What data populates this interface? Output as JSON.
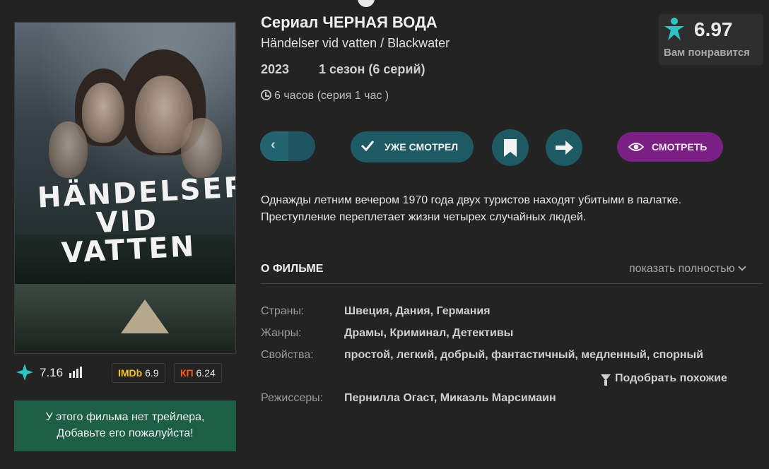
{
  "poster": {
    "title_art": "HÄNDELSER VID VATTEN"
  },
  "ratings": {
    "site_rating": "7.16",
    "imdb_label": "IMDb",
    "imdb_value": "6.9",
    "kp_label": "КП",
    "kp_value": "6.24"
  },
  "trailer_notice": {
    "line1": "У этого фильма нет трейлера,",
    "line2": "Добавьте его пожалуйста!"
  },
  "header": {
    "title": "Сериал ЧЕРНАЯ ВОДА",
    "original_title": "Händelser vid vatten / Blackwater",
    "year": "2023",
    "season": "1 сезон (6 серий)",
    "duration": "6 часов  (серия 1 час )"
  },
  "score": {
    "value": "6.97",
    "note": "Вам понравится"
  },
  "actions": {
    "seen_label": "УЖЕ СМОТРЕЛ",
    "watch_label": "СМОТРЕТЬ"
  },
  "description": {
    "line1": "Однажды летним вечером 1970 года двух туристов находят убитыми в палатке.",
    "line2": "Преступление переплетает жизни четырех случайных людей."
  },
  "about": {
    "heading": "О ФИЛЬМЕ",
    "show_full": "показать полностью",
    "countries_label": "Страны:",
    "countries": "Швеция,  Дания,  Германия",
    "genres_label": "Жанры:",
    "genres": "Драмы,  Криминал,  Детективы",
    "props_label": "Свойства:",
    "props": "простой,  легкий,  добрый,  фантастичный,  медленный,  спорный",
    "similar": "Подобрать похожие",
    "directors_label": "Режиссеры:",
    "directors": "Пернилла Огаст,  Микаэль Марсимаин"
  },
  "colors": {
    "accent_teal": "#1d5a63",
    "watch_purple": "#7a1f83",
    "trailer_green": "#1c5f45",
    "imdb_yellow": "#f5c518",
    "kp_orange": "#ff5c1a",
    "star_cyan": "#2ec4c4"
  },
  "icons": [
    "star-icon",
    "bars-icon",
    "clock-icon",
    "person-star-icon",
    "chevron-left-icon",
    "check-icon",
    "bookmark-icon",
    "arrow-right-icon",
    "eye-icon",
    "chevron-down-icon",
    "funnel-icon"
  ]
}
